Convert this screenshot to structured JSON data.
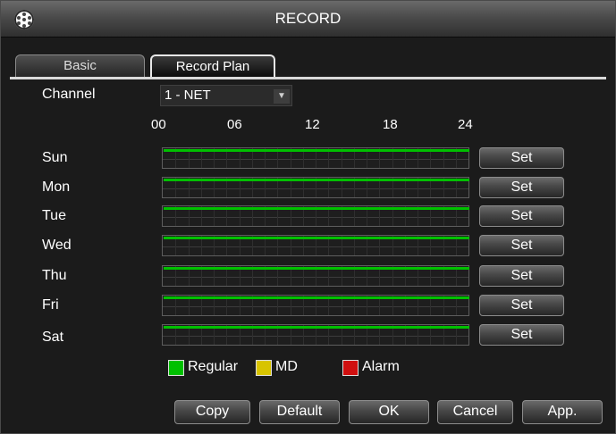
{
  "window": {
    "title": "RECORD"
  },
  "tabs": [
    {
      "label": "Basic"
    },
    {
      "label": "Record Plan"
    }
  ],
  "channel": {
    "label": "Channel",
    "value": "1 - NET"
  },
  "timeline": {
    "hours": [
      "00",
      "06",
      "12",
      "18",
      "24"
    ]
  },
  "days": [
    {
      "label": "Sun",
      "set_label": "Set",
      "regular_coverage": 1.0
    },
    {
      "label": "Mon",
      "set_label": "Set",
      "regular_coverage": 1.0
    },
    {
      "label": "Tue",
      "set_label": "Set",
      "regular_coverage": 1.0
    },
    {
      "label": "Wed",
      "set_label": "Set",
      "regular_coverage": 1.0
    },
    {
      "label": "Thu",
      "set_label": "Set",
      "regular_coverage": 1.0
    },
    {
      "label": "Fri",
      "set_label": "Set",
      "regular_coverage": 1.0
    },
    {
      "label": "Sat",
      "set_label": "Set",
      "regular_coverage": 1.0
    }
  ],
  "legend": [
    {
      "label": "Regular",
      "color": "#00c000"
    },
    {
      "label": "MD",
      "color": "#d8c400"
    },
    {
      "label": "Alarm",
      "color": "#d01010"
    }
  ],
  "buttons": {
    "copy": "Copy",
    "default": "Default",
    "ok": "OK",
    "cancel": "Cancel",
    "apply": "App."
  }
}
